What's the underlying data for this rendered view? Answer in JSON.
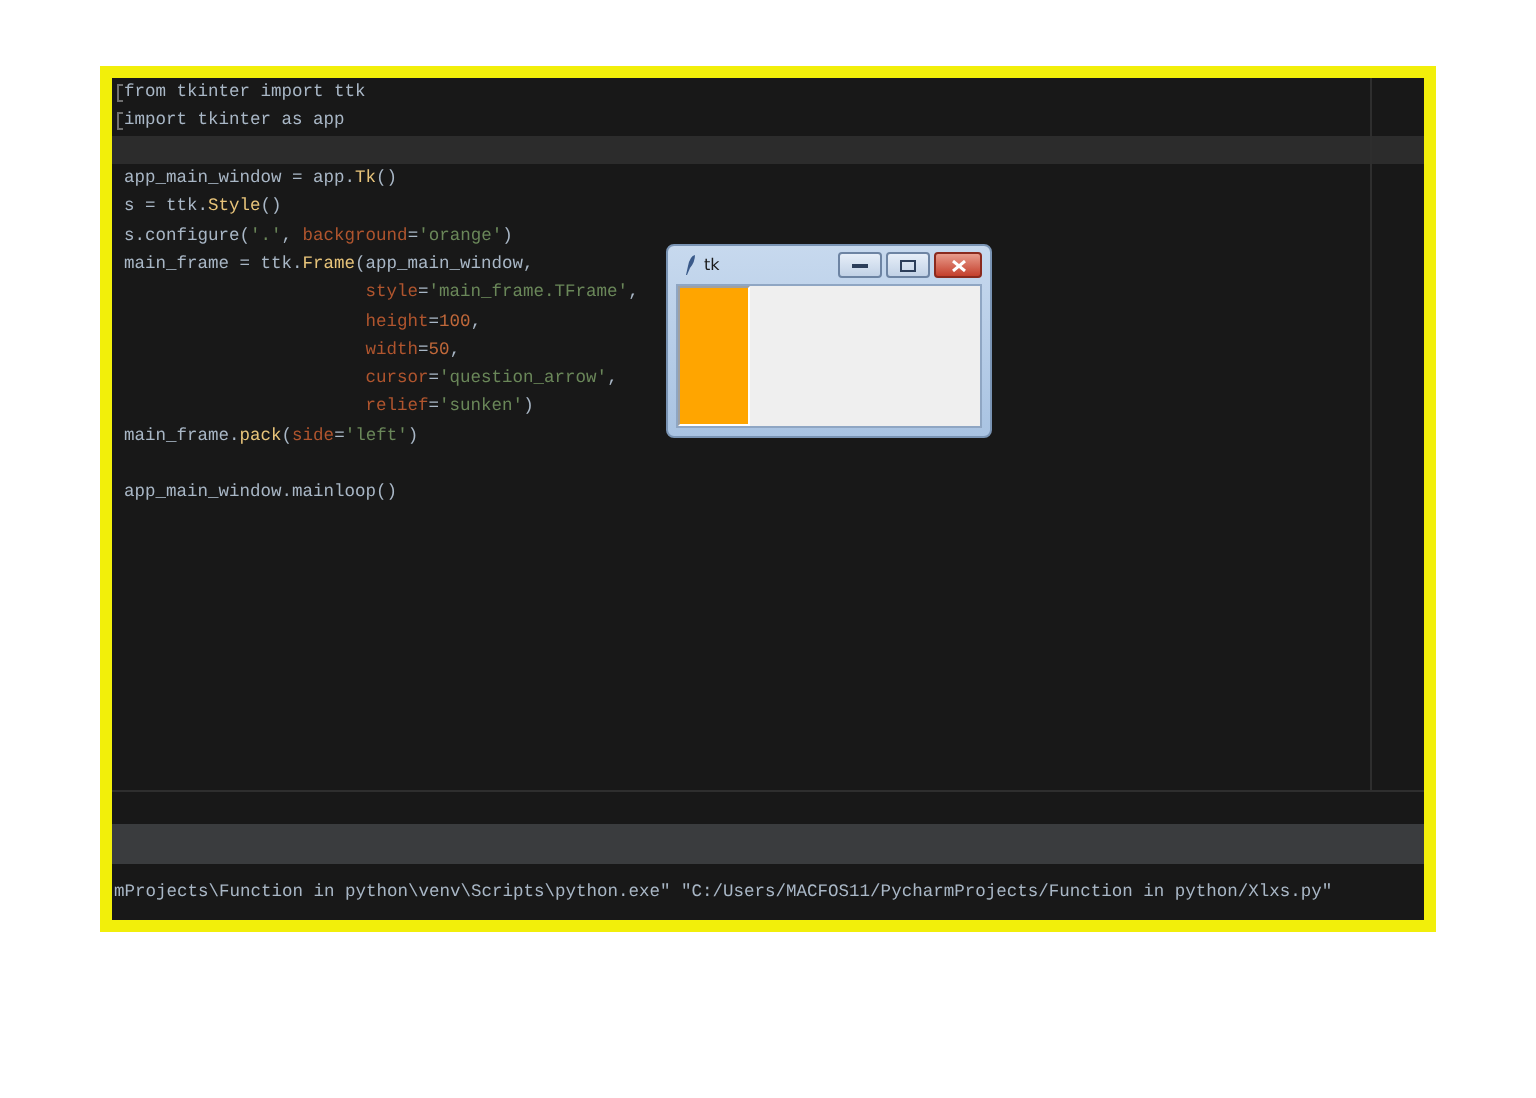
{
  "editor": {
    "lines": [
      {
        "fold": true,
        "current": false,
        "tokens": [
          {
            "kind": "plain",
            "text": "from tkinter import ttk"
          }
        ]
      },
      {
        "fold": true,
        "current": false,
        "tokens": [
          {
            "kind": "plain",
            "text": "import tkinter as app"
          }
        ]
      },
      {
        "fold": false,
        "current": true
      },
      {
        "fold": false,
        "current": false,
        "tokens": [
          {
            "kind": "plain",
            "text": "app_main_window = app."
          },
          {
            "kind": "func",
            "text": "Tk"
          },
          {
            "kind": "plain",
            "text": "()"
          }
        ]
      },
      {
        "fold": false,
        "current": false,
        "tokens": [
          {
            "kind": "plain",
            "text": "s = ttk."
          },
          {
            "kind": "func",
            "text": "Style"
          },
          {
            "kind": "plain",
            "text": "()"
          }
        ]
      },
      {
        "fold": false,
        "current": false,
        "tokens": [
          {
            "kind": "plain",
            "text": "s.configure("
          },
          {
            "kind": "string",
            "text": "'.'"
          },
          {
            "kind": "plain",
            "text": ", "
          },
          {
            "kind": "param",
            "text": "background"
          },
          {
            "kind": "plain",
            "text": "="
          },
          {
            "kind": "string",
            "text": "'orange'"
          },
          {
            "kind": "plain",
            "text": ")"
          }
        ]
      },
      {
        "fold": false,
        "current": false,
        "tokens": [
          {
            "kind": "plain",
            "text": "main_frame = ttk."
          },
          {
            "kind": "func",
            "text": "Frame"
          },
          {
            "kind": "plain",
            "text": "(app_main_window,"
          }
        ]
      },
      {
        "fold": false,
        "current": false,
        "tokens": [
          {
            "kind": "param",
            "text": "                       style"
          },
          {
            "kind": "plain",
            "text": "="
          },
          {
            "kind": "string",
            "text": "'main_frame.TFrame'"
          },
          {
            "kind": "plain",
            "text": ","
          }
        ]
      },
      {
        "fold": false,
        "current": false,
        "tokens": [
          {
            "kind": "param",
            "text": "                       height"
          },
          {
            "kind": "plain",
            "text": "="
          },
          {
            "kind": "number",
            "text": "100"
          },
          {
            "kind": "plain",
            "text": ","
          }
        ]
      },
      {
        "fold": false,
        "current": false,
        "tokens": [
          {
            "kind": "param",
            "text": "                       width"
          },
          {
            "kind": "plain",
            "text": "="
          },
          {
            "kind": "number",
            "text": "50"
          },
          {
            "kind": "plain",
            "text": ","
          }
        ]
      },
      {
        "fold": false,
        "current": false,
        "tokens": [
          {
            "kind": "param",
            "text": "                       cursor"
          },
          {
            "kind": "plain",
            "text": "="
          },
          {
            "kind": "string",
            "text": "'question_arrow'"
          },
          {
            "kind": "plain",
            "text": ","
          }
        ]
      },
      {
        "fold": false,
        "current": false,
        "tokens": [
          {
            "kind": "param",
            "text": "                       relief"
          },
          {
            "kind": "plain",
            "text": "="
          },
          {
            "kind": "string",
            "text": "'sunken'"
          },
          {
            "kind": "plain",
            "text": ")"
          }
        ]
      },
      {
        "fold": false,
        "current": false,
        "tokens": [
          {
            "kind": "plain",
            "text": "main_frame."
          },
          {
            "kind": "func",
            "text": "pack"
          },
          {
            "kind": "plain",
            "text": "("
          },
          {
            "kind": "param",
            "text": "side"
          },
          {
            "kind": "plain",
            "text": "="
          },
          {
            "kind": "string",
            "text": "'left'"
          },
          {
            "kind": "plain",
            "text": ")"
          }
        ]
      },
      {
        "fold": false,
        "current": false
      },
      {
        "fold": false,
        "current": false,
        "tokens": [
          {
            "kind": "plain",
            "text": "app_main_window.mainloop()"
          }
        ]
      }
    ]
  },
  "tk_window": {
    "title": "tk"
  },
  "terminal": {
    "command": "mProjects\\Function in python\\venv\\Scripts\\python.exe\" \"C:/Users/MACFOS11/PycharmProjects/Function in python/Xlxs.py\""
  }
}
